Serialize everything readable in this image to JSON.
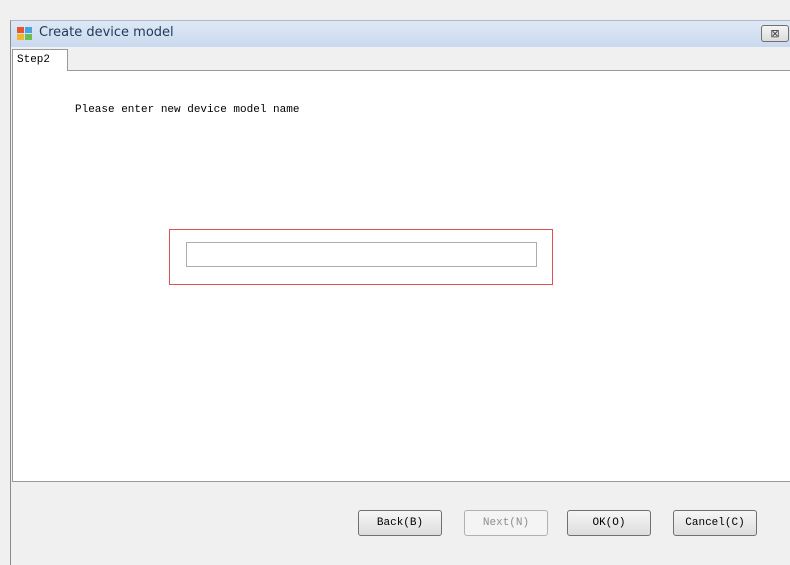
{
  "window": {
    "title": "Create device model",
    "close_glyph": "⊠"
  },
  "tab": {
    "label": "Step2"
  },
  "form": {
    "prompt": "Please enter new device model name",
    "input_value": "",
    "input_placeholder": ""
  },
  "buttons": {
    "back": "Back(B)",
    "next": "Next(N)",
    "ok": "OK(O)",
    "cancel": "Cancel(C)"
  },
  "colors": {
    "highlight_border": "#e05050",
    "title_text": "#1e395b"
  },
  "icons": {
    "app": "window-app-icon",
    "close": "close-icon"
  }
}
